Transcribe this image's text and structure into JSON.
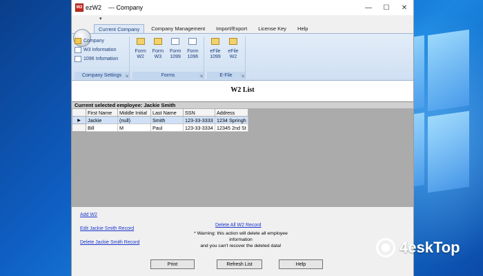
{
  "window": {
    "app_name": "ezW2",
    "document_title": "--- Company",
    "controls": {
      "minimize": "—",
      "maximize": "☐",
      "close": "✕"
    }
  },
  "tabs": [
    "Current Company",
    "Company Management",
    "Import/Export",
    "License Key",
    "Help"
  ],
  "ribbon": {
    "company_settings": {
      "items": [
        "Company",
        "W3 Information",
        "1096 Infomation"
      ],
      "label": "Company Settings"
    },
    "forms": {
      "buttons": [
        {
          "line1": "Form",
          "line2": "W2"
        },
        {
          "line1": "Form",
          "line2": "W3"
        },
        {
          "line1": "Form",
          "line2": "1099"
        },
        {
          "line1": "Form",
          "line2": "1096"
        }
      ],
      "label": "Forms"
    },
    "efile": {
      "buttons": [
        {
          "line1": "eFile",
          "line2": "1099"
        },
        {
          "line1": "eFile",
          "line2": "W2"
        }
      ],
      "label": "E-File"
    }
  },
  "page_title": "W2 List",
  "current_employee": "Current selected employee: Jackie Smith",
  "grid": {
    "columns": [
      "First Name",
      "Middle Initial",
      "Last Name",
      "SSN",
      "Address"
    ],
    "rows": [
      {
        "indicator": "▶",
        "cells": [
          "Jackie",
          "(null)",
          "Smith",
          "123-33-3333",
          "1234 Springh"
        ]
      },
      {
        "indicator": "",
        "cells": [
          "Bill",
          "M",
          "Paul",
          "123-33-3334",
          "12345 2nd St"
        ]
      }
    ]
  },
  "links": {
    "add": "Add W2",
    "edit": "Edit Jackie Smith Record",
    "delete": "Delete Jackie Smith Record",
    "delete_all": "Delete All W2 Record"
  },
  "warning": {
    "line1": "* Warning: this action will delete all employee information",
    "line2": "and you can't recover the deleted data!"
  },
  "buttons": {
    "print": "Print",
    "refresh": "Refresh List",
    "help": "Help"
  },
  "watermark": "4eskTop"
}
